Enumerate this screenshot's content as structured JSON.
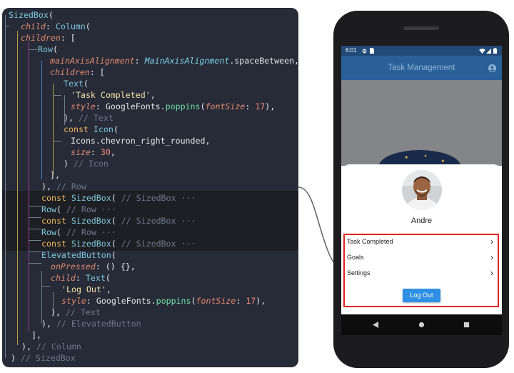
{
  "code": {
    "lines": [
      {
        "tokens": [
          {
            "t": "SizedBox",
            "c": "type"
          },
          {
            "t": "(",
            "c": "punc"
          }
        ]
      },
      {
        "tokens": [
          {
            "t": "child",
            "c": "prop"
          },
          {
            "t": ": ",
            "c": "punc"
          },
          {
            "t": "Column",
            "c": "type"
          },
          {
            "t": "(",
            "c": "punc"
          }
        ]
      },
      {
        "tokens": [
          {
            "t": "children",
            "c": "prop"
          },
          {
            "t": ": [",
            "c": "punc"
          }
        ]
      },
      {
        "tokens": [
          {
            "t": "Row",
            "c": "type"
          },
          {
            "t": "(",
            "c": "punc"
          }
        ]
      },
      {
        "tokens": [
          {
            "t": "mainAxisAlignment",
            "c": "prop"
          },
          {
            "t": ": ",
            "c": "punc"
          },
          {
            "t": "MainAxisAlignment",
            "c": "enum"
          },
          {
            "t": ".spaceBetween,",
            "c": "plain"
          }
        ]
      },
      {
        "tokens": [
          {
            "t": "children",
            "c": "prop"
          },
          {
            "t": ": [",
            "c": "punc"
          }
        ]
      },
      {
        "tokens": [
          {
            "t": "Text",
            "c": "type"
          },
          {
            "t": "(",
            "c": "punc"
          }
        ]
      },
      {
        "tokens": [
          {
            "t": "'Task Completed'",
            "c": "str"
          },
          {
            "t": ",",
            "c": "punc"
          }
        ]
      },
      {
        "tokens": [
          {
            "t": "style",
            "c": "prop"
          },
          {
            "t": ": ",
            "c": "punc"
          },
          {
            "t": "GoogleFonts",
            "c": "plain"
          },
          {
            "t": ".",
            "c": "punc"
          },
          {
            "t": "poppins",
            "c": "fn"
          },
          {
            "t": "(",
            "c": "punc"
          },
          {
            "t": "fontSize",
            "c": "prop"
          },
          {
            "t": ": ",
            "c": "punc"
          },
          {
            "t": "17",
            "c": "num"
          },
          {
            "t": "),",
            "c": "punc"
          }
        ]
      },
      {
        "tokens": [
          {
            "t": "), ",
            "c": "punc"
          },
          {
            "t": "// Text",
            "c": "comment"
          }
        ]
      },
      {
        "tokens": [
          {
            "t": "const ",
            "c": "kw"
          },
          {
            "t": "Icon",
            "c": "type"
          },
          {
            "t": "(",
            "c": "punc"
          }
        ]
      },
      {
        "tokens": [
          {
            "t": "Icons",
            "c": "plain"
          },
          {
            "t": ".chevron_right_rounded,",
            "c": "plain"
          }
        ]
      },
      {
        "tokens": [
          {
            "t": "size",
            "c": "prop"
          },
          {
            "t": ": ",
            "c": "punc"
          },
          {
            "t": "30",
            "c": "num"
          },
          {
            "t": ",",
            "c": "punc"
          }
        ]
      },
      {
        "tokens": [
          {
            "t": ") ",
            "c": "punc"
          },
          {
            "t": "// Icon",
            "c": "comment"
          }
        ]
      },
      {
        "tokens": [
          {
            "t": "],",
            "c": "punc"
          }
        ]
      },
      {
        "tokens": [
          {
            "t": "), ",
            "c": "punc"
          },
          {
            "t": "// Row",
            "c": "comment"
          }
        ]
      },
      {
        "tokens": [
          {
            "t": "const ",
            "c": "kw"
          },
          {
            "t": "SizedBox",
            "c": "type"
          },
          {
            "t": "( ",
            "c": "punc"
          },
          {
            "t": "// SizedBox ···",
            "c": "comment"
          }
        ]
      },
      {
        "tokens": [
          {
            "t": "Row",
            "c": "type"
          },
          {
            "t": "( ",
            "c": "punc"
          },
          {
            "t": "// Row ···",
            "c": "comment"
          }
        ]
      },
      {
        "tokens": [
          {
            "t": "const ",
            "c": "kw"
          },
          {
            "t": "SizedBox",
            "c": "type"
          },
          {
            "t": "( ",
            "c": "punc"
          },
          {
            "t": "// SizedBox ···",
            "c": "comment"
          }
        ]
      },
      {
        "tokens": [
          {
            "t": "Row",
            "c": "type"
          },
          {
            "t": "( ",
            "c": "punc"
          },
          {
            "t": "// Row ···",
            "c": "comment"
          }
        ]
      },
      {
        "tokens": [
          {
            "t": "const ",
            "c": "kw"
          },
          {
            "t": "SizedBox",
            "c": "type"
          },
          {
            "t": "( ",
            "c": "punc"
          },
          {
            "t": "// SizedBox ···",
            "c": "comment"
          }
        ]
      },
      {
        "tokens": [
          {
            "t": "ElevatedButton",
            "c": "type"
          },
          {
            "t": "(",
            "c": "punc"
          }
        ]
      },
      {
        "tokens": [
          {
            "t": "onPressed",
            "c": "prop"
          },
          {
            "t": ": () {},",
            "c": "punc"
          }
        ]
      },
      {
        "tokens": [
          {
            "t": "child",
            "c": "prop"
          },
          {
            "t": ": ",
            "c": "punc"
          },
          {
            "t": "Text",
            "c": "type"
          },
          {
            "t": "(",
            "c": "punc"
          }
        ]
      },
      {
        "tokens": [
          {
            "t": "'Log Out'",
            "c": "str"
          },
          {
            "t": ",",
            "c": "punc"
          }
        ]
      },
      {
        "tokens": [
          {
            "t": "style",
            "c": "prop"
          },
          {
            "t": ": ",
            "c": "punc"
          },
          {
            "t": "GoogleFonts",
            "c": "plain"
          },
          {
            "t": ".",
            "c": "punc"
          },
          {
            "t": "poppins",
            "c": "fn"
          },
          {
            "t": "(",
            "c": "punc"
          },
          {
            "t": "fontSize",
            "c": "prop"
          },
          {
            "t": ": ",
            "c": "punc"
          },
          {
            "t": "17",
            "c": "num"
          },
          {
            "t": "),",
            "c": "punc"
          }
        ]
      },
      {
        "tokens": [
          {
            "t": "), ",
            "c": "punc"
          },
          {
            "t": "// Text",
            "c": "comment"
          }
        ]
      },
      {
        "tokens": [
          {
            "t": "), ",
            "c": "punc"
          },
          {
            "t": "// ElevatedButton",
            "c": "comment"
          }
        ]
      },
      {
        "tokens": [
          {
            "t": "],",
            "c": "punc"
          }
        ]
      },
      {
        "tokens": [
          {
            "t": "), ",
            "c": "punc"
          },
          {
            "t": "// Column",
            "c": "comment"
          }
        ]
      },
      {
        "tokens": [
          {
            "t": ") ",
            "c": "punc"
          },
          {
            "t": "// SizedBox",
            "c": "comment"
          }
        ]
      }
    ]
  },
  "phone": {
    "status": {
      "time": "6:01"
    },
    "app_bar": {
      "title": "Task Management"
    },
    "profile": {
      "name": "Andre"
    },
    "menu": [
      {
        "label": "Task Completed"
      },
      {
        "label": "Goals"
      },
      {
        "label": "Settings"
      }
    ],
    "logout_label": "Log Out"
  },
  "colors": {
    "highlight_border": "#e0231f",
    "logout_button": "#2f8fe4",
    "app_bar": "#2a6098"
  }
}
